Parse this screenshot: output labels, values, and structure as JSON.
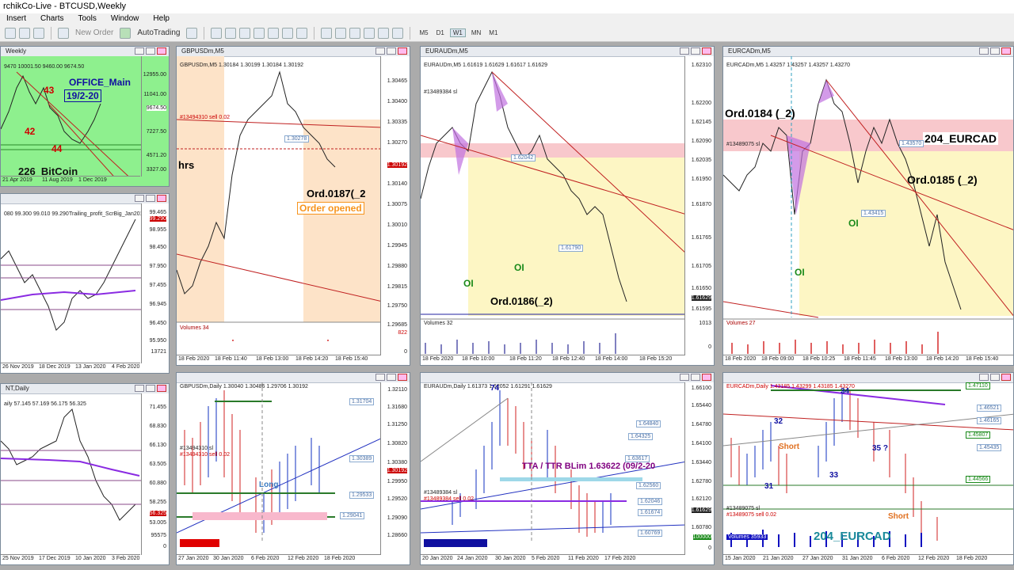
{
  "app": {
    "title": "rchikCo-Live - BTCUSD,Weekly",
    "menu": [
      "Insert",
      "Charts",
      "Tools",
      "Window",
      "Help"
    ],
    "toolbar": {
      "new_order": "New Order",
      "auto_trading": "AutoTrading",
      "timeframes": [
        "M5",
        "D1",
        "W1",
        "MN",
        "M1"
      ],
      "active_timeframe": "W1"
    }
  },
  "windows": {
    "btc": {
      "title": "Weekly",
      "ohlc": "9470 10001.50 9460.00 9674.50",
      "labels": {
        "office": "OFFICE_Main",
        "date": "19/2-20",
        "n43": "43",
        "n42": "42",
        "n44": "44",
        "coin": "226_BitCoin"
      },
      "y_ticks": [
        "12955.00",
        "11041.00",
        "9674.50",
        "7227.50",
        "4571.20",
        "3327.00"
      ],
      "x_ticks": [
        "21 Apr 2019",
        "11 Aug 2019",
        "1 Dec 2019"
      ],
      "bg": "#8ef08e"
    },
    "left_mid": {
      "ohlc": "080 99.300 99.010 99.290",
      "extra": "Trailing_profit_ScrBig_Jan2019",
      "y_ticks": [
        "99.465",
        "99.290",
        "98.955",
        "98.450",
        "97.950",
        "97.455",
        "96.945",
        "96.450",
        "95.950",
        "13721"
      ],
      "x_ticks": [
        "26 Nov 2019",
        "18 Dec 2019",
        "13 Jan 2020",
        "4 Feb 2020"
      ]
    },
    "left_bot": {
      "title": "NT,Daily",
      "ohlc": "aily 57.145 57.169 56.175 56.325",
      "y_ticks": [
        "71.455",
        "68.830",
        "66.130",
        "63.505",
        "60.880",
        "58.255",
        "56.325",
        "53.005",
        "95575",
        "0"
      ],
      "x_ticks": [
        "25 Nov 2019",
        "17 Dec 2019",
        "10 Jan 2020",
        "3 Feb 2020"
      ]
    },
    "gbp_m5": {
      "title": "GBPUSDm,M5",
      "ohlc": "GBPUSDm,M5 1.30184 1.30199 1.30184 1.30192",
      "sell": "#13494310 sell 0.02",
      "hrs": "hrs",
      "ord": "Ord.0187(_2",
      "opened": "Order opened",
      "volumes": "Volumes 34",
      "y_ticks": [
        "1.30465",
        "1.30400",
        "1.30335",
        "1.30270",
        "1.30192",
        "1.30140",
        "1.30075",
        "1.30010",
        "1.29945",
        "1.29880",
        "1.29815",
        "1.29750",
        "1.29685",
        "822",
        "0"
      ],
      "x_ticks": [
        "18 Feb 2020",
        "18 Feb 11:40",
        "18 Feb 13:00",
        "18 Feb 14:20",
        "18 Feb 15:40"
      ],
      "level_box": "1.30278"
    },
    "eur_aud_m5": {
      "title": "EURAUDm,M5",
      "ohlc": "EURAUDm,M5 1.61619 1.61629 1.61617 1.61629",
      "ticket": "#13489384 sl",
      "oi1": "OI",
      "oi2": "OI",
      "ord": "Ord.0186(_2)",
      "volumes": "Volumes 32",
      "y_ticks": [
        "1.62310",
        "1.62200",
        "1.62145",
        "1.62090",
        "1.62035",
        "1.61950",
        "1.61870",
        "1.61765",
        "1.61705",
        "1.61650",
        "1.61629",
        "1.61595",
        "1013",
        "0"
      ],
      "x_ticks": [
        "18 Feb 2020",
        "18 Feb 10:00",
        "18 Feb 11:20",
        "18 Feb 12:40",
        "18 Feb 14:00",
        "18 Feb 15:20"
      ],
      "level_a": "1.62042",
      "level_b": "1.61790"
    },
    "eur_cad_m5": {
      "title": "EURCADm,M5",
      "ohlc": "EURCADm,M5 1.43257 1.43257 1.43257 1.43270",
      "ticket": "#13489075 sl",
      "ord184": "Ord.0184 (_2)",
      "pair": "204_EURCAD",
      "ord185": "Ord.0185 (_2)",
      "oi1": "OI",
      "oi2": "OI",
      "volumes": "Volumes 27",
      "x_ticks": [
        "18 Feb 2020",
        "18 Feb 09:00",
        "18 Feb 10:25",
        "18 Feb 11:45",
        "18 Feb 13:00",
        "18 Feb 14:20",
        "18 Feb 15:40"
      ],
      "level_a": "1.43570",
      "level_b": "1.43415"
    },
    "gbp_d1": {
      "title": "GBPUSDm,Daily",
      "ohlc": "GBPUSDm,Daily 1.30040 1.30486 1.29706 1.30192",
      "ticket": "#13494310 sl",
      "sell": "#13494310 sell 0.02",
      "long": "Long",
      "y_ticks": [
        "1.32110",
        "1.31680",
        "1.31250",
        "1.30820",
        "1.30380",
        "1.30192",
        "1.29950",
        "1.29520",
        "1.29090",
        "1.28660"
      ],
      "x_ticks": [
        "27 Jan 2020",
        "30 Jan 2020",
        "6 Feb 2020",
        "12 Feb 2020",
        "18 Feb 2020"
      ],
      "boxes": [
        "1.31704",
        "1.30389",
        "1.29533",
        "1.29041"
      ]
    },
    "eur_aud_d1": {
      "title": "EURAUDm,Daily",
      "ohlc": "EURAUDm,Daily 1.61373 1.62052 1.61291 1.61629",
      "n74": "74",
      "tta": "TTA / TTR BLim 1.63622 (09/2-20",
      "ticket": "#13489384 sl",
      "sell": "#13489384 sell 0.02",
      "y_ticks": [
        "1.66100",
        "1.65440",
        "1.64780",
        "1.64100",
        "1.63440",
        "1.62780",
        "1.62120",
        "1.61629",
        "1.60780",
        "100000",
        "0"
      ],
      "x_ticks": [
        "20 Jan 2020",
        "24 Jan 2020",
        "30 Jan 2020",
        "5 Feb 2020",
        "11 Feb 2020",
        "17 Feb 2020"
      ],
      "boxes": [
        "1.64840",
        "1.64325",
        "1.63617",
        "1.62560",
        "1.62046",
        "1.61674",
        "1.60769"
      ]
    },
    "eur_cad_d1": {
      "title": "EURCADm,Daily",
      "ohlc": "EURCADm,Daily 1.43185 1.43299 1.43185 1.43270",
      "labels": {
        "n34": "34",
        "n32": "32",
        "short1": "Short",
        "n35": "35 ?",
        "n33": "33",
        "n31": "31",
        "short2": "Short"
      },
      "ticket": "#13489075 sl",
      "sell": "#13489075 sell 0.02",
      "pair": "204_EURCAD",
      "volumes": "Volumes 35933",
      "x_ticks": [
        "15 Jan 2020",
        "21 Jan 2020",
        "27 Jan 2020",
        "31 Jan 2020",
        "6 Feb 2020",
        "12 Feb 2020",
        "18 Feb 2020"
      ],
      "boxes": [
        "1.47110",
        "1.46521",
        "1.46165",
        "1.45807",
        "1.45435",
        "1.44566"
      ]
    }
  }
}
